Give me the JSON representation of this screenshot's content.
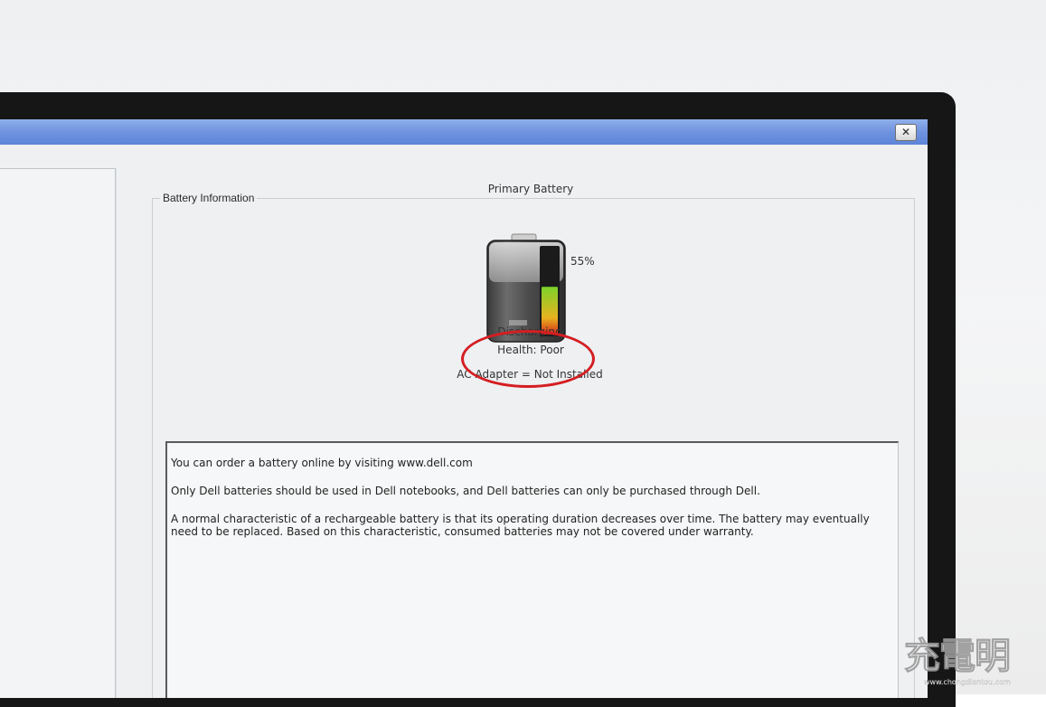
{
  "window": {
    "close_label": "✕"
  },
  "battery_info": {
    "group_title": "Battery Information",
    "battery_name": "Primary Battery",
    "charge_percent_label": "55%",
    "charge_fraction": 0.55,
    "status": "Discharging",
    "health": "Health: Poor",
    "ac_adapter": "AC Adapter = Not Installed"
  },
  "info_text": {
    "order_line": "You can order a battery online by visiting www.dell.com",
    "compat_line": "Only Dell batteries should be used in Dell notebooks, and Dell batteries can only be purchased through Dell.",
    "normal_line": "A normal characteristic of a rechargeable battery is that its operating duration decreases over time.  The battery may eventually need to be replaced.  Based on this characteristic, consumed batteries may not be covered under warranty."
  },
  "watermark": {
    "glyphs": "充電明",
    "url": "www.chongdiantou.com"
  },
  "colors": {
    "titlebar": "#6f93df",
    "annotation": "#d41e22",
    "charge_low": "#d42a1a",
    "charge_high": "#7cd32a"
  }
}
